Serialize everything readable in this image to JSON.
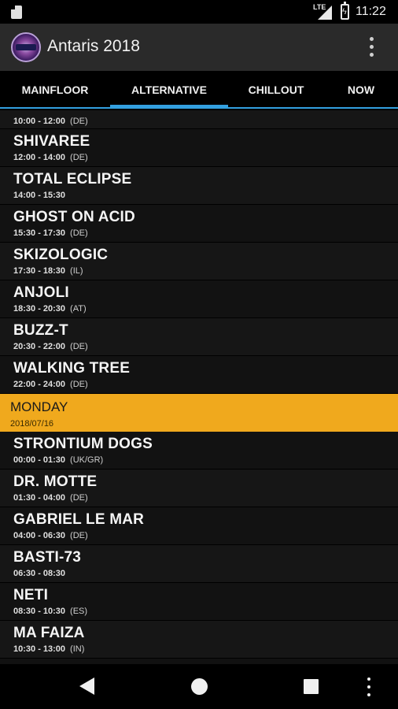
{
  "status_bar": {
    "network": "LTE",
    "time": "11:22"
  },
  "app_bar": {
    "title": "Antaris 2018"
  },
  "tabs": [
    {
      "label": "MAINFLOOR"
    },
    {
      "label": "ALTERNATIVE",
      "active": true
    },
    {
      "label": "CHILLOUT"
    },
    {
      "label": "NOW"
    }
  ],
  "schedule": {
    "first_partial_time": "10:00 - 12:00",
    "first_partial_country": "(DE)",
    "before_day": [
      {
        "name": "SHIVAREE",
        "time": "12:00 - 14:00",
        "country": "(DE)"
      },
      {
        "name": "TOTAL ECLIPSE",
        "time": "14:00 - 15:30",
        "country": ""
      },
      {
        "name": "GHOST ON ACID",
        "time": "15:30 - 17:30",
        "country": "(DE)"
      },
      {
        "name": "SKIZOLOGIC",
        "time": "17:30 - 18:30",
        "country": "(IL)"
      },
      {
        "name": "ANJOLI",
        "time": "18:30 - 20:30",
        "country": "(AT)"
      },
      {
        "name": "BUZZ-T",
        "time": "20:30 - 22:00",
        "country": "(DE)"
      },
      {
        "name": "WALKING TREE",
        "time": "22:00 - 24:00",
        "country": "(DE)"
      }
    ],
    "day_header": {
      "day": "MONDAY",
      "date": "2018/07/16",
      "color": "#f0a91d"
    },
    "after_day": [
      {
        "name": "STRONTIUM DOGS",
        "time": "00:00 - 01:30",
        "country": "(UK/GR)"
      },
      {
        "name": "DR. MOTTE",
        "time": "01:30 - 04:00",
        "country": "(DE)"
      },
      {
        "name": "GABRIEL LE MAR",
        "time": "04:00 - 06:30",
        "country": "(DE)"
      },
      {
        "name": "BASTI-73",
        "time": "06:30 - 08:30",
        "country": ""
      },
      {
        "name": "NETI",
        "time": "08:30 - 10:30",
        "country": "(ES)"
      },
      {
        "name": "MA FAIZA",
        "time": "10:30 - 13:00",
        "country": "(IN)"
      }
    ]
  },
  "colors": {
    "accent": "#33a0e0",
    "day_header": "#f0a91d",
    "appbar": "#2a2a2a"
  }
}
